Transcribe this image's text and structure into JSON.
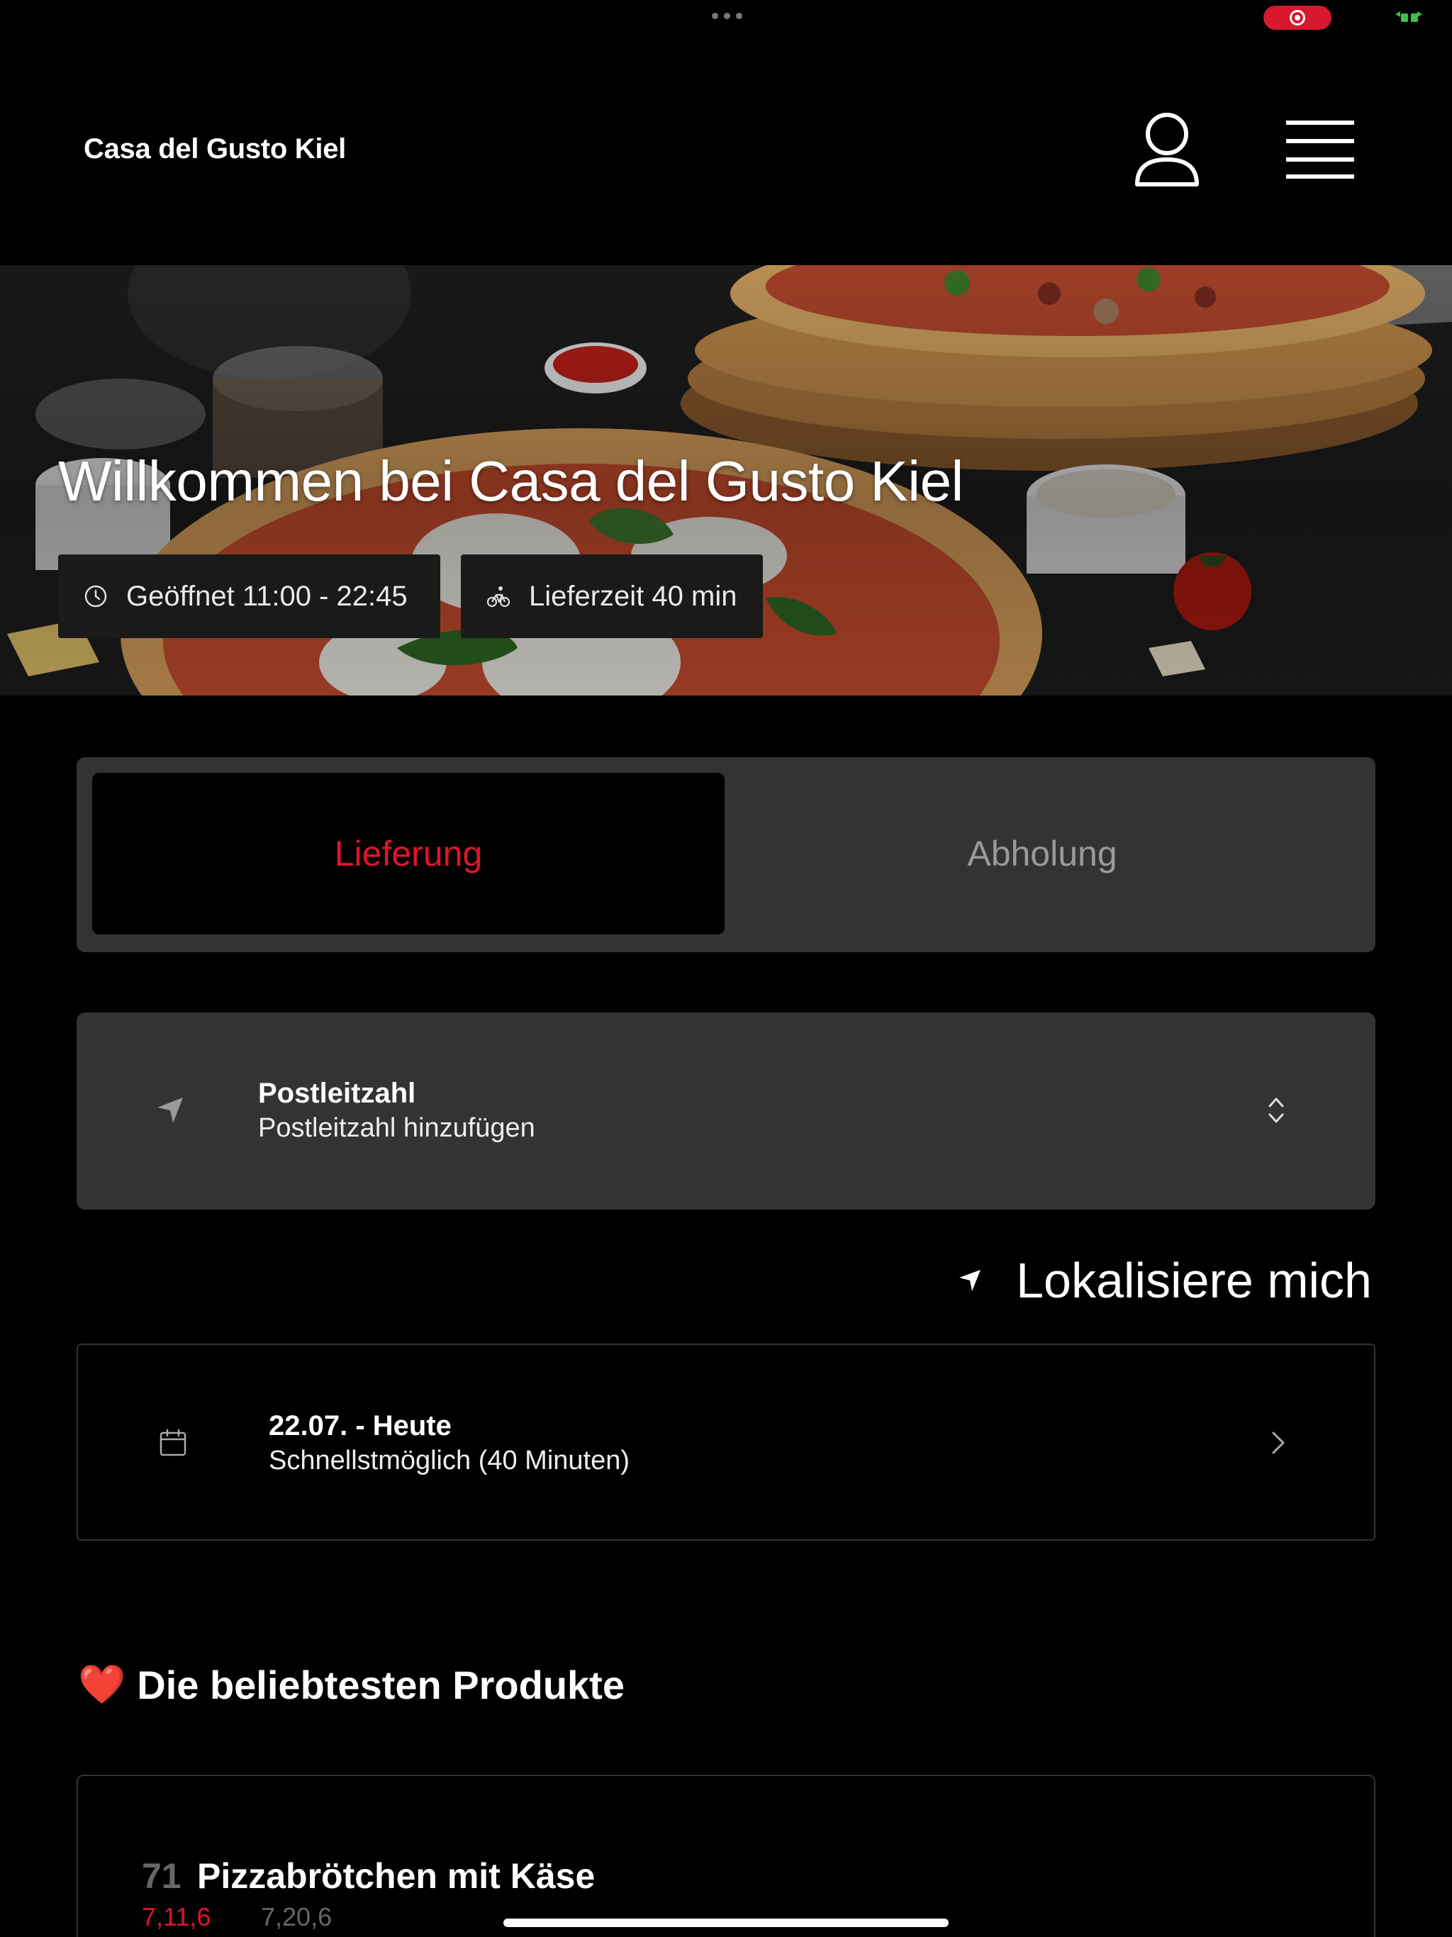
{
  "header": {
    "title": "Casa del Gusto Kiel",
    "user_icon": "user-icon",
    "menu_icon": "hamburger-menu-icon"
  },
  "hero": {
    "title": "Willkommen bei Casa del Gusto Kiel",
    "opening_hours": "Geöffnet 11:00 - 22:45",
    "delivery_time": "Lieferzeit 40 min"
  },
  "order_mode": {
    "options": [
      "Lieferung",
      "Abholung"
    ],
    "selected": "Lieferung"
  },
  "postal": {
    "label": "Postleitzahl",
    "placeholder": "Postleitzahl hinzufügen"
  },
  "locate": {
    "label": "Lokalisiere mich"
  },
  "schedule": {
    "date": "22.07. - Heute",
    "time": "Schnellstmöglich (40 Minuten)"
  },
  "popular": {
    "title": "Die beliebtesten Produkte",
    "emoji": "❤️",
    "items": [
      {
        "number": "71",
        "name": "Pizzabrötchen mit Käse",
        "tag_a": "7,11,6",
        "tag_b": "7,20,6"
      }
    ]
  },
  "colors": {
    "accent": "#e0142b",
    "panel": "#333333",
    "background": "#000000"
  }
}
